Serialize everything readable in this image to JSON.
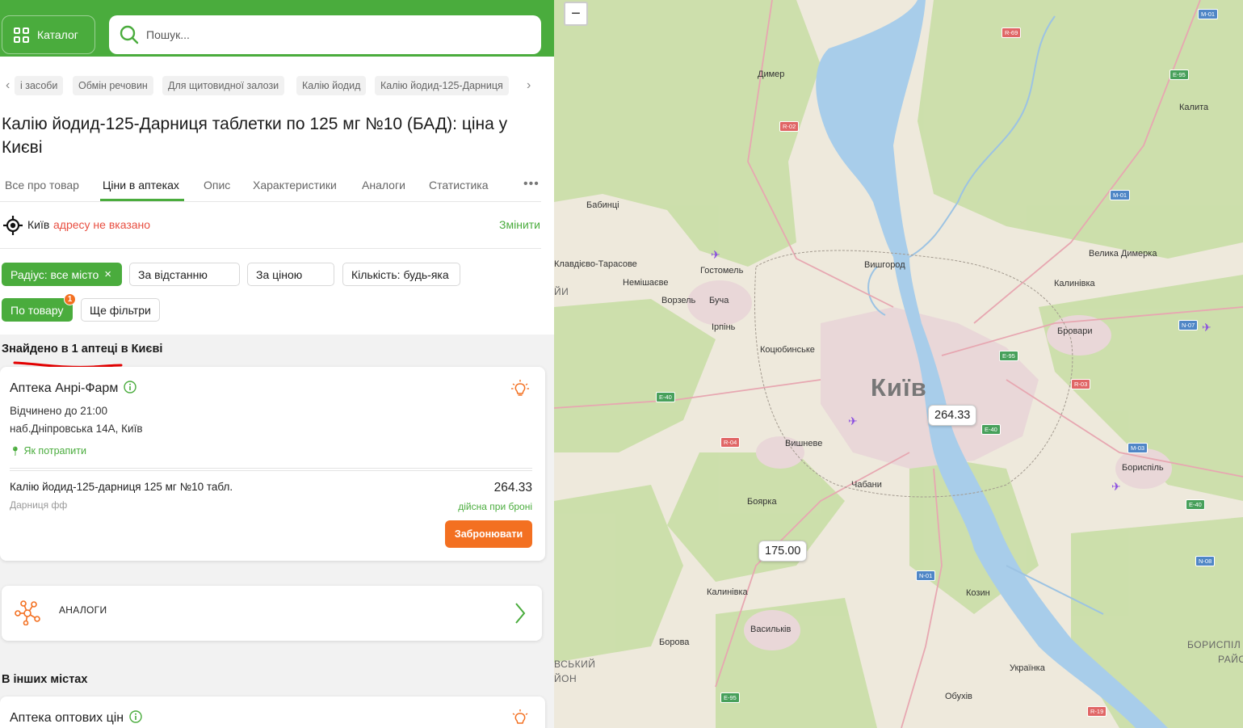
{
  "header": {
    "catalog_label": "Каталог",
    "search_placeholder": "Пошук..."
  },
  "breadcrumb": [
    "і засоби",
    "Обмін речовин",
    "Для щитовидної залози",
    "Калію йодид",
    "Калію йодид-125-Дарниця"
  ],
  "page_title": "Калію йодид-125-Дарниця таблетки по 125 мг №10 (БАД): ціна у Києві",
  "tabs": [
    "Все про товар",
    "Ціни в аптеках",
    "Опис",
    "Характеристики",
    "Аналоги",
    "Статистика"
  ],
  "active_tab": "Ціни в аптеках",
  "location": {
    "city": "Київ",
    "warning": "адресу не вказано",
    "change_label": "Змінити"
  },
  "filters": {
    "radius": "Радіус: все місто",
    "by_distance": "За відстанню",
    "by_price": "За ціною",
    "quantity": "Кількість: будь-яка",
    "by_product": "По товару",
    "by_product_badge": "1",
    "more_filters": "Ще фільтри"
  },
  "found_text": "Знайдено в 1 аптеці в Києві",
  "pharmacy": {
    "name": "Аптека Анрі-Фарм",
    "hours": "Відчинено до 21:00",
    "address": "наб.Дніпровська 14А, Київ",
    "route_label": "Як потрапити",
    "product_name": "Калію йодид-125-дарниця 125 мг №10 табл.",
    "product_maker": "Дарниця фф",
    "price": "264.33",
    "price_note": "дійсна при броні",
    "reserve_label": "Забронювати"
  },
  "analogs_label": "АНАЛОГИ",
  "other_cities_title": "В інших містах",
  "pharmacy2_name": "Аптека оптових цін",
  "map": {
    "zoom_out_label": "−",
    "price_pins": [
      "264.33",
      "175.00"
    ],
    "city_label": "Київ",
    "places": [
      "Димер",
      "Калита",
      "Бабинці",
      "Клавдієво-Тарасове",
      "Гостомель",
      "Вишгород",
      "Велика Димерка",
      "Немішаєве",
      "Ворзель",
      "Буча",
      "Калинівка",
      "Ірпінь",
      "Бровари",
      "Коцюбинське",
      "Вишневе",
      "Бориспіль",
      "Чабани",
      "Боярка",
      "Калинівка",
      "Васильків",
      "Козин",
      "Борова",
      "Українка",
      "Обухів"
    ],
    "district_labels": [
      "ЙИ",
      "ВСЬКИЙ",
      "ЙОН",
      "БОРИСПІЛ",
      "РАЙО"
    ],
    "road_shields": [
      "M-01",
      "R-69",
      "E-95",
      "R-02",
      "M-01",
      "N-07",
      "E-95",
      "R-03",
      "E-40",
      "E-40",
      "R-04",
      "M-03",
      "E-40",
      "N-08",
      "N-01",
      "E-95",
      "R-19"
    ],
    "colors": {
      "water": "#a8cdea",
      "forest": "#c9dea6",
      "urban": "#eddcdf",
      "brand_green": "#4aac3d",
      "accent_orange": "#f37021"
    }
  }
}
